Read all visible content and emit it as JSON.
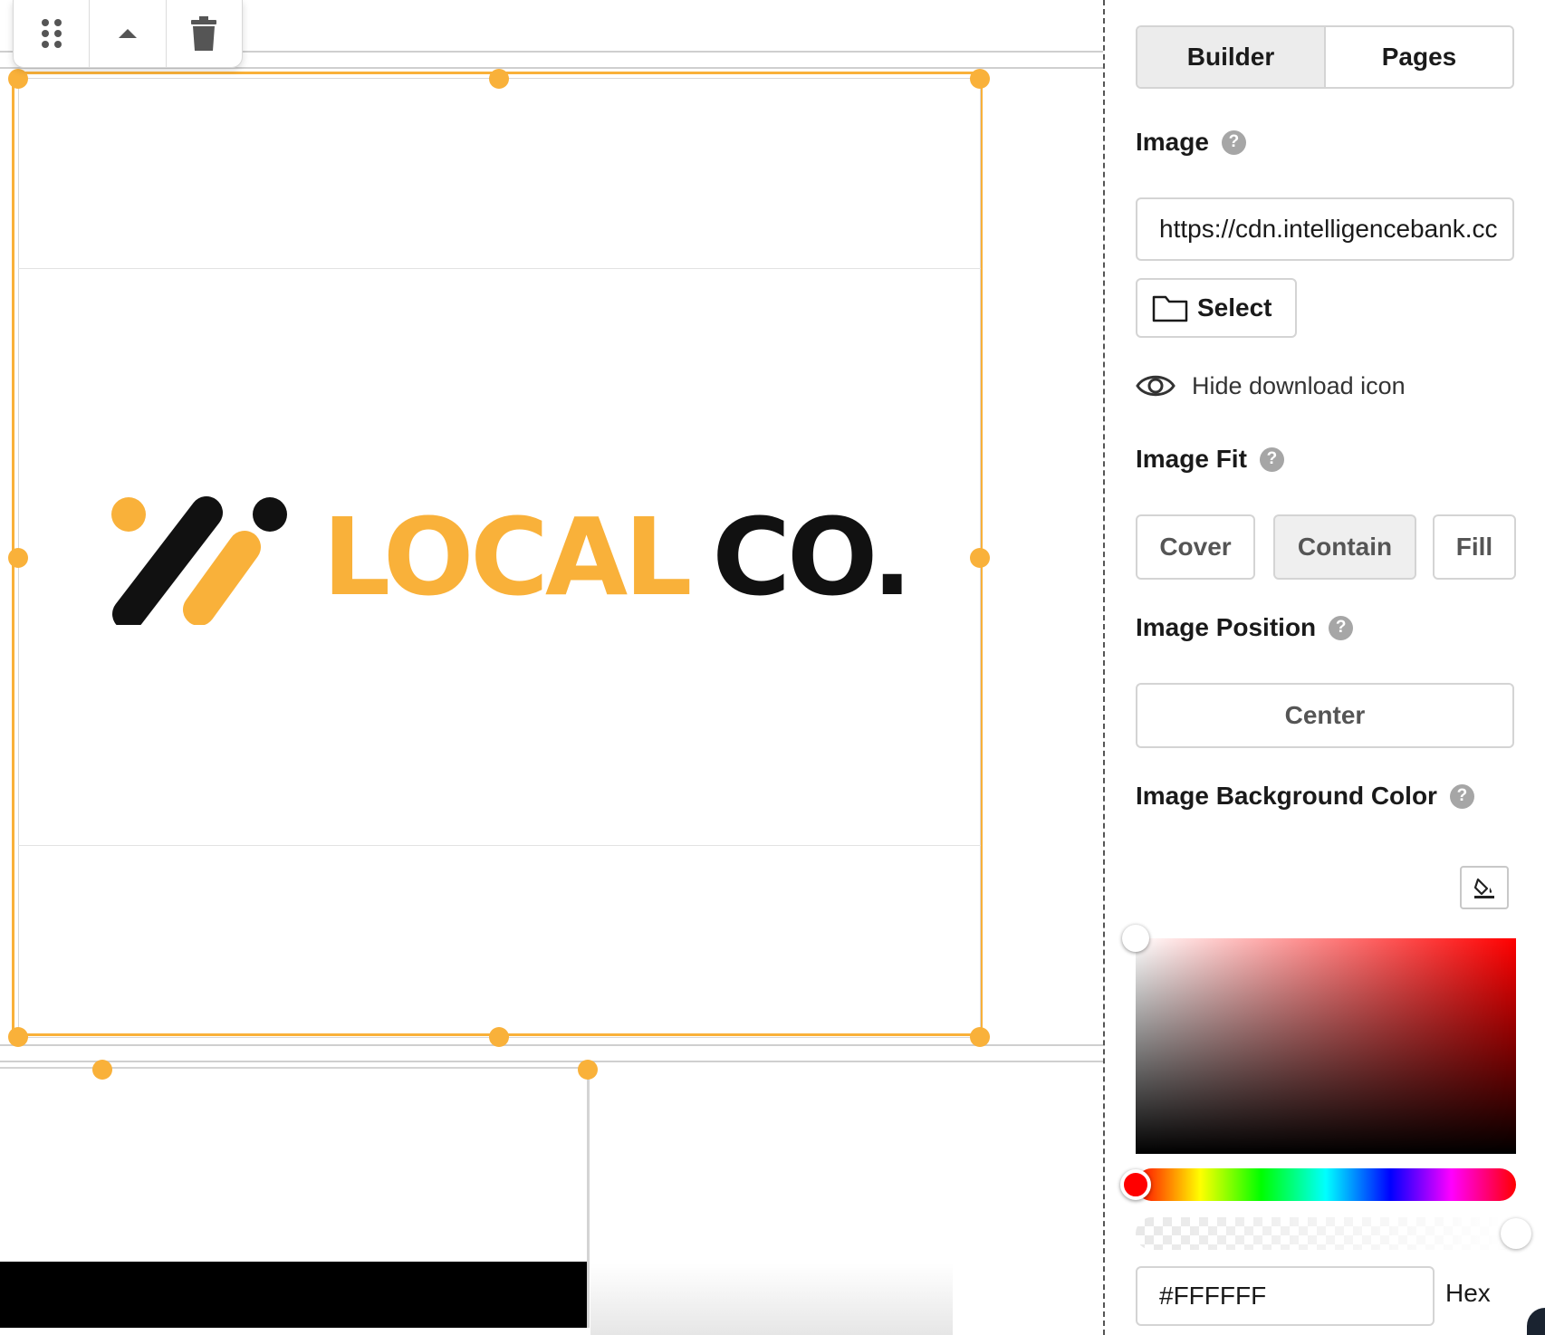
{
  "toolbar": {
    "icons": [
      "drag-handle-icon",
      "move-up-icon",
      "trash-icon"
    ]
  },
  "logo": {
    "word_primary": "LOCAL",
    "word_secondary": "CO",
    "dot": ".",
    "colors": {
      "accent": "#f9b13a",
      "dark": "#111111"
    }
  },
  "panel": {
    "tabs": [
      {
        "label": "Builder",
        "active": true
      },
      {
        "label": "Pages",
        "active": false
      }
    ],
    "image": {
      "label": "Image",
      "help": "?",
      "url_value": "https://cdn.intelligencebank.cc",
      "select_label": "Select",
      "hide_download_label": "Hide download icon"
    },
    "image_fit": {
      "label": "Image Fit",
      "help": "?",
      "options": [
        "Cover",
        "Contain",
        "Fill"
      ],
      "selected": "Contain"
    },
    "image_position": {
      "label": "Image Position",
      "help": "?",
      "value": "Center"
    },
    "background_color": {
      "label": "Image Background Color",
      "help": "?",
      "hex_value": "#FFFFFF",
      "format_label": "Hex",
      "hue_color": "#ff0000"
    }
  },
  "colors": {
    "selection": "#f9b13a",
    "border": "#d4d4d4",
    "active_tab_bg": "#ececec"
  }
}
